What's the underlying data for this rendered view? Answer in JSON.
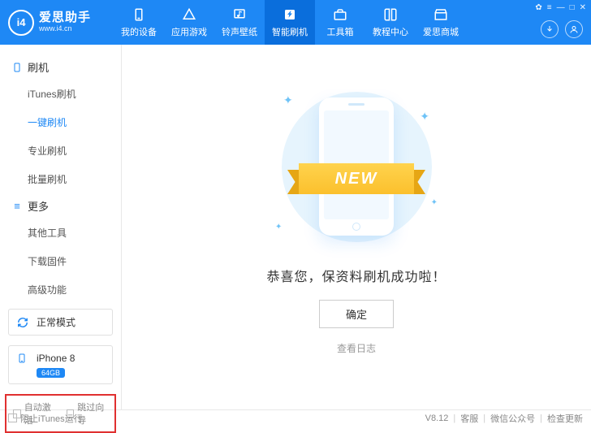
{
  "logo": {
    "badge": "i4",
    "title": "爱思助手",
    "url": "www.i4.cn"
  },
  "nav": [
    {
      "label": "我的设备"
    },
    {
      "label": "应用游戏"
    },
    {
      "label": "铃声壁纸"
    },
    {
      "label": "智能刷机"
    },
    {
      "label": "工具箱"
    },
    {
      "label": "教程中心"
    },
    {
      "label": "爱思商城"
    }
  ],
  "sidebar": {
    "section1": {
      "title": "刷机",
      "items": [
        "iTunes刷机",
        "一键刷机",
        "专业刷机",
        "批量刷机"
      ]
    },
    "section2": {
      "title": "更多",
      "items": [
        "其他工具",
        "下载固件",
        "高级功能"
      ]
    }
  },
  "mode": {
    "label": "正常模式"
  },
  "device": {
    "name": "iPhone 8",
    "storage": "64GB"
  },
  "options": {
    "auto_activate": "自动激活",
    "skip_guide": "跳过向导"
  },
  "main": {
    "ribbon": "NEW",
    "message": "恭喜您，保资料刷机成功啦！",
    "confirm": "确定",
    "view_log": "查看日志"
  },
  "footer": {
    "block_itunes": "阻止iTunes运行",
    "version": "V8.12",
    "support": "客服",
    "wechat": "微信公众号",
    "update": "检查更新"
  }
}
